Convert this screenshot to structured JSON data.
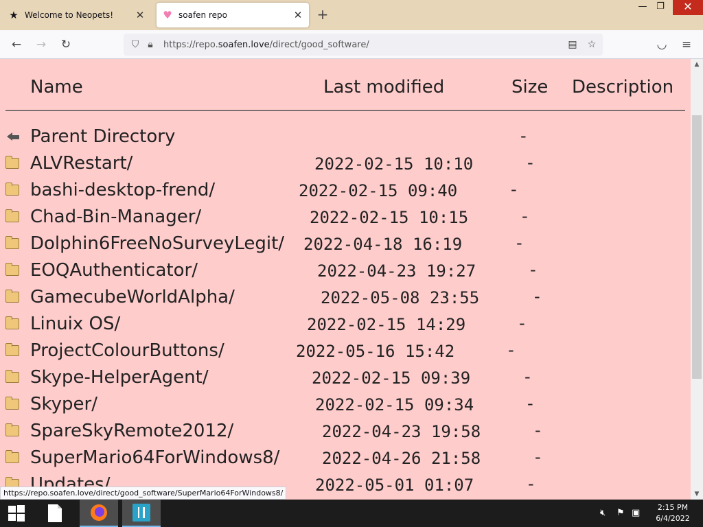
{
  "browser": {
    "tabs": [
      {
        "title": "Welcome to Neopets!",
        "icon": "star-icon",
        "active": false
      },
      {
        "title": "soafen repo",
        "icon": "heart-icon",
        "active": true
      }
    ],
    "url_prefix": "https://repo.",
    "url_domain": "soafen.love",
    "url_path": "/direct/good_software/",
    "status_url": "https://repo.soafen.love/direct/good_software/SuperMario64ForWindows8/"
  },
  "listing": {
    "headers": {
      "name": "Name",
      "modified": "Last modified",
      "size": "Size",
      "description": "Description"
    },
    "rows": [
      {
        "name": "Parent Directory",
        "date": "",
        "size": "-",
        "icon": "back-arrow-icon"
      },
      {
        "name": "ALVRestart/",
        "date": "2022-02-15 10:10",
        "size": "-",
        "icon": "folder-icon"
      },
      {
        "name": "bashi-desktop-frend/",
        "date": "2022-02-15 09:40",
        "size": "-",
        "icon": "folder-icon"
      },
      {
        "name": "Chad-Bin-Manager/",
        "date": "2022-02-15 10:15",
        "size": "-",
        "icon": "folder-icon"
      },
      {
        "name": "Dolphin6FreeNoSurveyLegit/",
        "date": "2022-04-18 16:19",
        "size": "-",
        "icon": "folder-icon"
      },
      {
        "name": "EOQAuthenticator/",
        "date": "2022-04-23 19:27",
        "size": "-",
        "icon": "folder-icon"
      },
      {
        "name": "GamecubeWorldAlpha/",
        "date": "2022-05-08 23:55",
        "size": "-",
        "icon": "folder-icon"
      },
      {
        "name": "Linuix OS/",
        "date": "2022-02-15 14:29",
        "size": "-",
        "icon": "folder-icon"
      },
      {
        "name": "ProjectColourButtons/",
        "date": "2022-05-16 15:42",
        "size": "-",
        "icon": "folder-icon"
      },
      {
        "name": "Skype-HelperAgent/",
        "date": "2022-02-15 09:39",
        "size": "-",
        "icon": "folder-icon"
      },
      {
        "name": "Skyper/",
        "date": "2022-02-15 09:34",
        "size": "-",
        "icon": "folder-icon"
      },
      {
        "name": "SpareSkyRemote2012/",
        "date": "2022-04-23 19:58",
        "size": "-",
        "icon": "folder-icon"
      },
      {
        "name": "SuperMario64ForWindows8/",
        "date": "2022-04-26 21:58",
        "size": "-",
        "icon": "folder-icon"
      },
      {
        "name": "Updates/",
        "date": "2022-05-01 01:07",
        "size": "-",
        "icon": "folder-icon"
      }
    ]
  },
  "taskbar": {
    "time": "2:15 PM",
    "date": "6/4/2022"
  },
  "colors": {
    "page_background": "#ffcccc",
    "tab_strip": "#e8d6b8",
    "taskbar": "#1c1c1c"
  }
}
